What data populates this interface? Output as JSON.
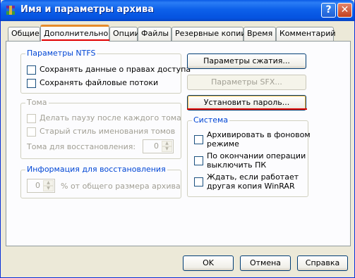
{
  "window": {
    "title": "Имя и параметры архива",
    "help_glyph": "?",
    "close_glyph": "✕",
    "title_color": "#0a5ae6",
    "accent_color": "#e00000"
  },
  "tabs": [
    {
      "label": "Общие"
    },
    {
      "label": "Дополнительно"
    },
    {
      "label": "Опции"
    },
    {
      "label": "Файлы"
    },
    {
      "label": "Резервные копии"
    },
    {
      "label": "Время"
    },
    {
      "label": "Комментарий"
    }
  ],
  "ntfs": {
    "legend": "Параметры NTFS",
    "opt1": "Сохранять данные о правах доступа",
    "opt2": "Сохранять файловые потоки"
  },
  "volumes": {
    "legend": "Тома",
    "opt1": "Делать паузу после каждого тома",
    "opt2": "Старый стиль именования томов",
    "recovery_label": "Тома для восстановления:",
    "recovery_value": "0"
  },
  "recovery": {
    "legend": "Информация для восстановления",
    "value": "0",
    "suffix": "% от общего размера архива"
  },
  "buttons": {
    "compression": "Параметры сжатия...",
    "sfx": "Параметры SFX...",
    "password": "Установить пароль..."
  },
  "system": {
    "legend": "Система",
    "opt1_line1": "Архивировать в фоновом",
    "opt1_line2": "режиме",
    "opt2_line1": "По окончании операции",
    "opt2_line2": "выключить ПК",
    "opt3_line1": "Ждать, если работает",
    "opt3_line2": "другая копия WinRAR"
  },
  "footer": {
    "ok": "OK",
    "cancel": "Отмена",
    "help": "Справка"
  }
}
